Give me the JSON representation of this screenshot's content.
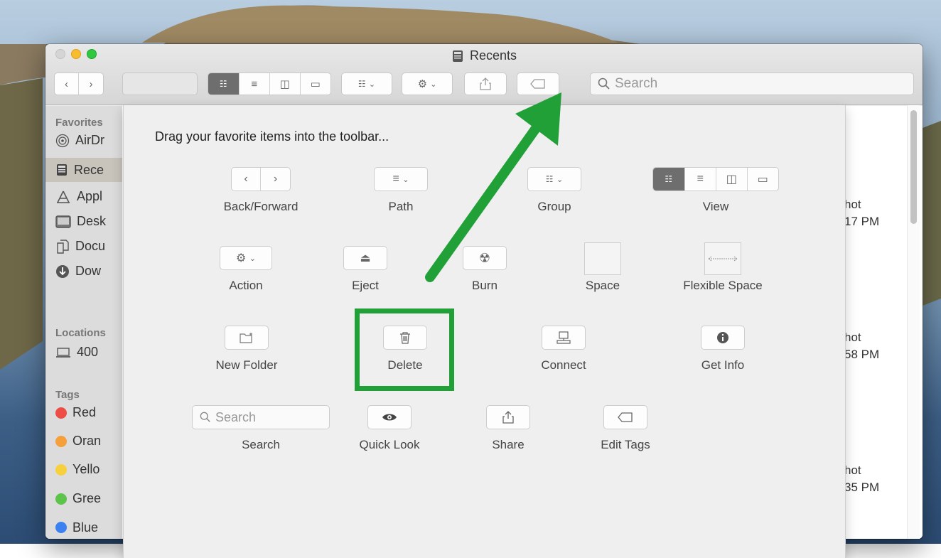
{
  "window": {
    "title": "Recents"
  },
  "toolbar": {
    "search_placeholder": "Search"
  },
  "sidebar": {
    "favorites_header": "Favorites",
    "favorites": [
      {
        "label": "AirDr",
        "icon": "airdrop-icon"
      },
      {
        "label": "Rece",
        "icon": "recents-icon"
      },
      {
        "label": "Appl",
        "icon": "applications-icon"
      },
      {
        "label": "Desk",
        "icon": "desktop-icon"
      },
      {
        "label": "Docu",
        "icon": "documents-icon"
      },
      {
        "label": "Dow",
        "icon": "downloads-icon"
      }
    ],
    "locations_header": "Locations",
    "locations": [
      {
        "label": "400",
        "icon": "laptop-icon"
      }
    ],
    "tags_header": "Tags",
    "tags": [
      {
        "label": "Red",
        "color": "#ee4d45"
      },
      {
        "label": "Oran",
        "color": "#f5a03a"
      },
      {
        "label": "Yello",
        "color": "#f6d13d"
      },
      {
        "label": "Gree",
        "color": "#5cc44b"
      },
      {
        "label": "Blue",
        "color": "#3b82f0"
      }
    ]
  },
  "files": [
    {
      "line1": "hot",
      "line2": "17 PM"
    },
    {
      "line1": "hot",
      "line2": "58 PM"
    },
    {
      "line1": "hot",
      "line2": "35 PM"
    }
  ],
  "customize": {
    "heading": "Drag your favorite items into the toolbar...",
    "items": {
      "back_forward": "Back/Forward",
      "path": "Path",
      "group": "Group",
      "view": "View",
      "action": "Action",
      "eject": "Eject",
      "burn": "Burn",
      "space": "Space",
      "flexible_space": "Flexible Space",
      "new_folder": "New Folder",
      "delete": "Delete",
      "connect": "Connect",
      "get_info": "Get Info",
      "search": "Search",
      "quick_look": "Quick Look",
      "share": "Share",
      "edit_tags": "Edit Tags"
    },
    "search_placeholder": "Search"
  },
  "annotation": {
    "arrow_color": "#21a038",
    "highlight_color": "#21a038"
  }
}
